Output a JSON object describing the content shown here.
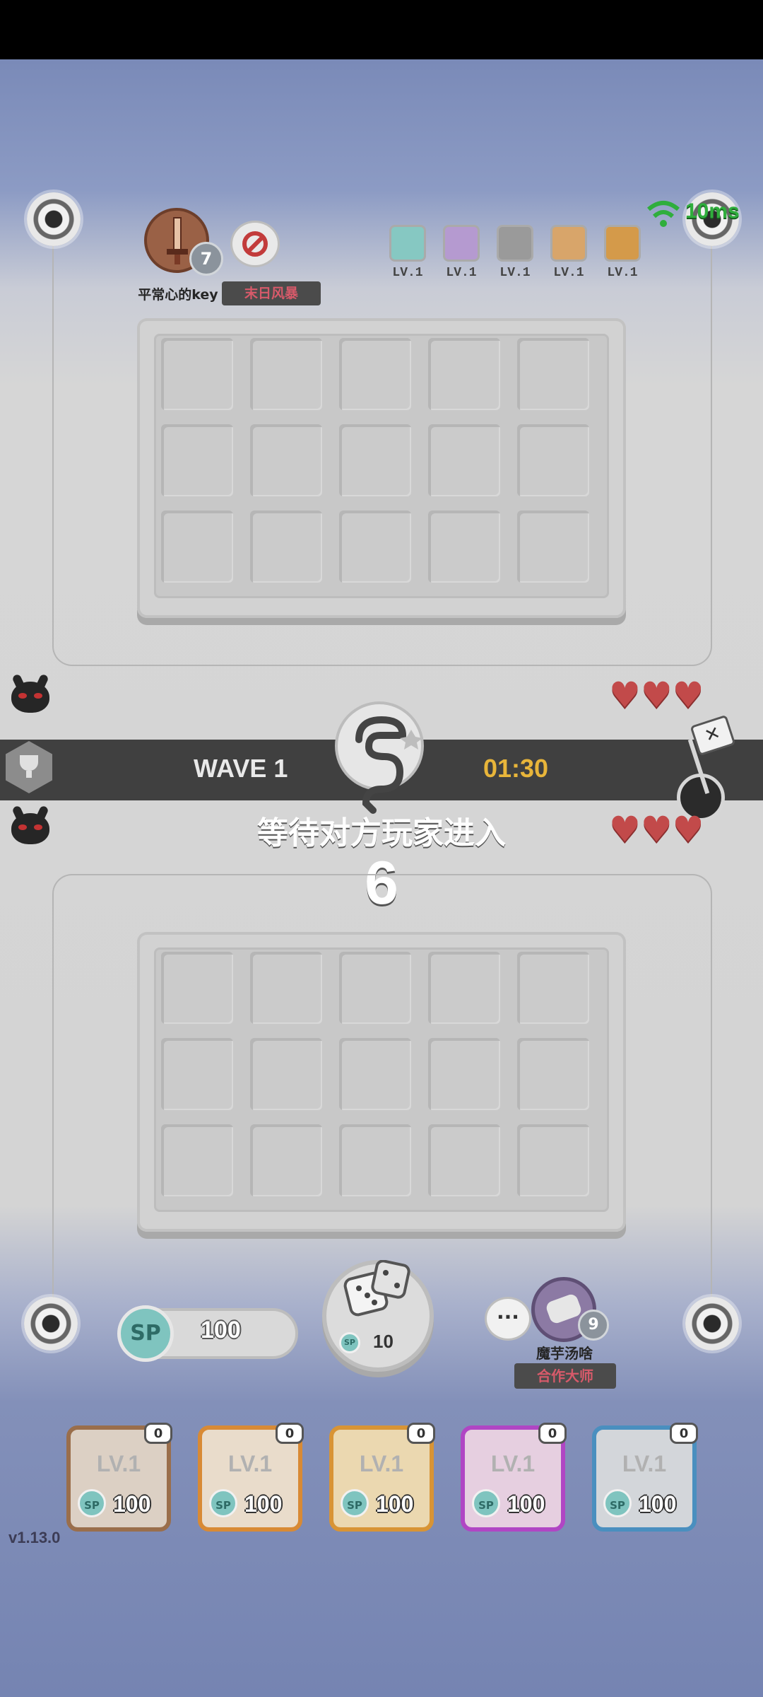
{
  "opponent": {
    "name": "平常心的key",
    "level": "7",
    "title": "末日风暴",
    "ping": "10ms",
    "relics": [
      {
        "label": "LV.1",
        "color": "#86c8c2"
      },
      {
        "label": "LV.1",
        "color": "#b59ad0"
      },
      {
        "label": "LV.1",
        "color": "#9a9a9a"
      },
      {
        "label": "LV.1",
        "color": "#d8a56a"
      },
      {
        "label": "LV.1",
        "color": "#d49a4a"
      }
    ],
    "lives": 3
  },
  "wave": {
    "label": "WAVE 1",
    "timer": "01:30"
  },
  "overlay": {
    "message": "等待对方玩家进入",
    "countdown": "6"
  },
  "player": {
    "name": "魔芋汤啥",
    "level": "9",
    "title": "合作大师",
    "lives": 3,
    "sp_label": "SP",
    "sp_value": "100",
    "summon_cost": "10",
    "summon_sp": "SP",
    "chat": "···"
  },
  "deck": [
    {
      "label": "LV.1",
      "sp": "SP",
      "cost": "100",
      "lock": "0",
      "border": "#9a6e4b",
      "fill": "#dcd0c4"
    },
    {
      "label": "LV.1",
      "sp": "SP",
      "cost": "100",
      "lock": "0",
      "border": "#d88a35",
      "fill": "#e9dccb"
    },
    {
      "label": "LV.1",
      "sp": "SP",
      "cost": "100",
      "lock": "0",
      "border": "#d89435",
      "fill": "#ebd8b0"
    },
    {
      "label": "LV.1",
      "sp": "SP",
      "cost": "100",
      "lock": "0",
      "border": "#b046c4",
      "fill": "#e6cfe0"
    },
    {
      "label": "LV.1",
      "sp": "SP",
      "cost": "100",
      "lock": "0",
      "border": "#4a8fbf",
      "fill": "#d3d6da"
    }
  ],
  "version": "v1.13.0",
  "colors": {
    "accent_timer": "#e8b53a",
    "ping_green": "#2fae3c",
    "title_badge": "#d75a6a"
  }
}
